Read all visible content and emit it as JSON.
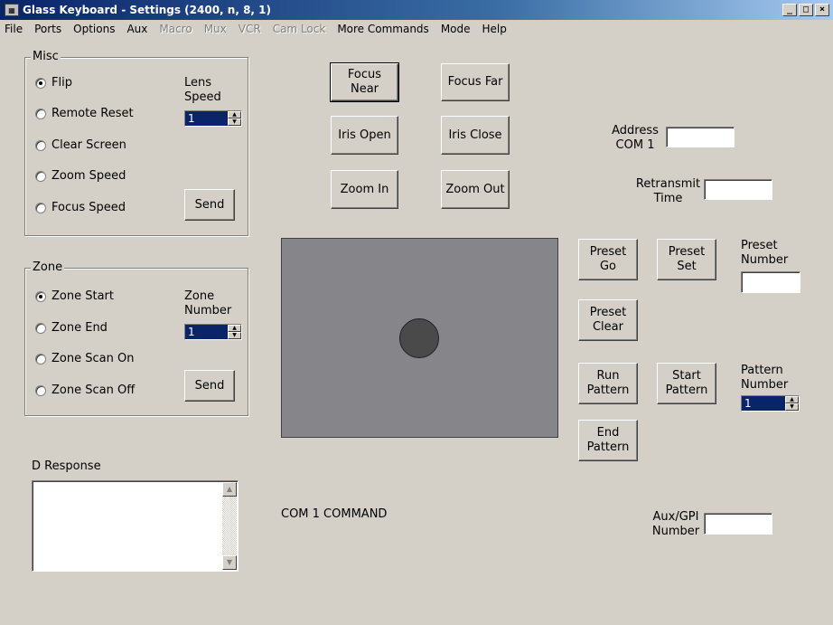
{
  "window": {
    "title": "Glass Keyboard - Settings (2400, n, 8, 1)",
    "minimize": "_",
    "maximize": "□",
    "close": "×"
  },
  "menu": [
    {
      "label": "File",
      "enabled": true
    },
    {
      "label": "Ports",
      "enabled": true
    },
    {
      "label": "Options",
      "enabled": true
    },
    {
      "label": "Aux",
      "enabled": true
    },
    {
      "label": "Macro",
      "enabled": false
    },
    {
      "label": "Mux",
      "enabled": false
    },
    {
      "label": "VCR",
      "enabled": false
    },
    {
      "label": "Cam Lock",
      "enabled": false
    },
    {
      "label": "More Commands",
      "enabled": true
    },
    {
      "label": "Mode",
      "enabled": true
    },
    {
      "label": "Help",
      "enabled": true
    }
  ],
  "misc": {
    "legend": "Misc",
    "options": [
      "Flip",
      "Remote Reset",
      "Clear Screen",
      "Zoom Speed",
      "Focus Speed"
    ],
    "selected": 0,
    "lens_speed_label": "Lens\nSpeed",
    "lens_speed_value": "1",
    "send_label": "Send"
  },
  "zone": {
    "legend": "Zone",
    "options": [
      "Zone Start",
      "Zone End",
      "Zone Scan On",
      "Zone Scan Off"
    ],
    "selected": 0,
    "zone_number_label": "Zone\nNumber",
    "zone_number_value": "1",
    "send_label": "Send"
  },
  "lens": {
    "focus_near": "Focus\nNear",
    "focus_far": "Focus Far",
    "iris_open": "Iris Open",
    "iris_close": "Iris Close",
    "zoom_in": "Zoom In",
    "zoom_out": "Zoom Out"
  },
  "address": {
    "label": "Address\nCOM 1",
    "value": ""
  },
  "retransmit": {
    "label": "Retransmit\nTime",
    "value": ""
  },
  "preset": {
    "go": "Preset\nGo",
    "set": "Preset\nSet",
    "clear": "Preset\nClear",
    "number_label": "Preset\nNumber",
    "number_value": ""
  },
  "pattern": {
    "run": "Run\nPattern",
    "start": "Start\nPattern",
    "end": "End\nPattern",
    "number_label": "Pattern\nNumber",
    "number_value": "1"
  },
  "response": {
    "label": "D Response",
    "value": ""
  },
  "status": {
    "command": "COM 1 COMMAND"
  },
  "aux": {
    "label": "Aux/GPI\nNumber",
    "value": ""
  },
  "colors": {
    "face": "#d4d0c8",
    "pad": "#868589",
    "knob": "#4a4a4a",
    "spin_highlight": "#0a246a"
  }
}
